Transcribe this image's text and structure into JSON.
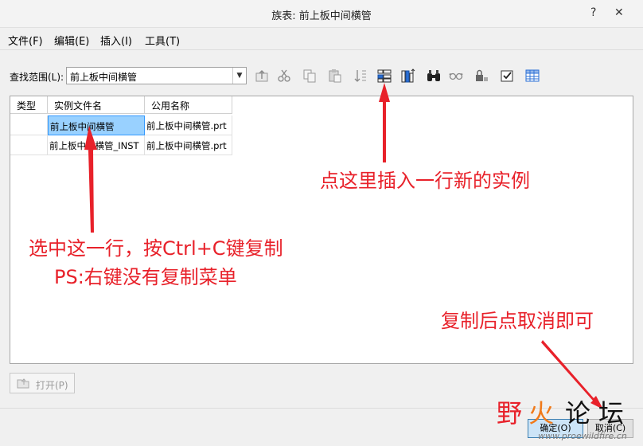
{
  "window": {
    "title": "族表: 前上板中间横管",
    "help_glyph": "?",
    "close_glyph": "✕"
  },
  "menu": [
    {
      "label": "文件(F)"
    },
    {
      "label": "编辑(E)"
    },
    {
      "label": "插入(I)"
    },
    {
      "label": "工具(T)"
    }
  ],
  "lookin": {
    "label": "查找范围(L):",
    "value": "前上板中间横管"
  },
  "toolbar": [
    {
      "icon": "up-level-icon"
    },
    {
      "icon": "cut-icon"
    },
    {
      "icon": "copy-icon"
    },
    {
      "icon": "paste-icon"
    },
    {
      "icon": "sort-icon"
    },
    {
      "icon": "insert-instance-icon"
    },
    {
      "icon": "insert-column-icon"
    },
    {
      "icon": "find-binoculars-icon"
    },
    {
      "icon": "preview-glasses-icon"
    },
    {
      "icon": "lock-icon"
    },
    {
      "icon": "verify-icon"
    },
    {
      "icon": "table-icon"
    }
  ],
  "table": {
    "columns": [
      "类型",
      "实例文件名",
      "公用名称"
    ],
    "rows": [
      {
        "type": "",
        "file": "前上板中间横管",
        "common": "前上板中间横管.prt",
        "selected": true
      },
      {
        "type": "",
        "file": "前上板中间横管_INST",
        "common": "前上板中间横管.prt",
        "selected": false
      }
    ]
  },
  "open_button": {
    "label": "打开(P)"
  },
  "buttons": {
    "ok": "确定(O)",
    "cancel": "取消(C)"
  },
  "annotations": {
    "insert_note": "点这里插入一行新的实例",
    "copy_note_line1": "选中这一行，按Ctrl+C键复制",
    "copy_note_line2": "PS:右键没有复制菜单",
    "cancel_note": "复制后点取消即可",
    "color": "#e8212a"
  },
  "watermark": {
    "chars": [
      "野",
      "火",
      "论",
      "坛"
    ],
    "url": "www.proewildfire.cn"
  }
}
